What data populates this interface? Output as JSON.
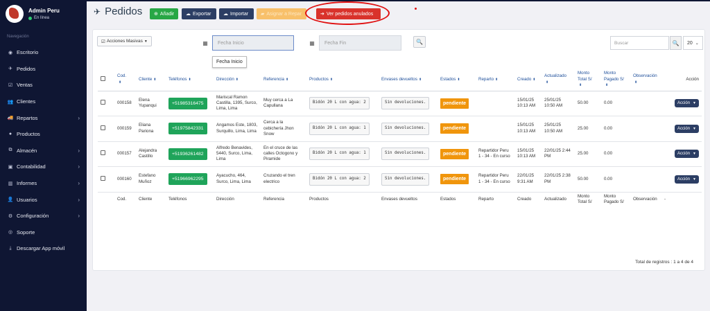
{
  "sidebar": {
    "user": {
      "name": "Admin Peru",
      "status": "En línea"
    },
    "section_label": "Navegación",
    "items": [
      {
        "label": "Escritorio",
        "icon": "dashboard-icon",
        "glyph": "◉",
        "submenu": false
      },
      {
        "label": "Pedidos",
        "icon": "rocket-icon",
        "glyph": "✈",
        "submenu": false
      },
      {
        "label": "Ventas",
        "icon": "check-square-icon",
        "glyph": "☑",
        "submenu": false
      },
      {
        "label": "Clientes",
        "icon": "users-icon",
        "glyph": "👥",
        "submenu": false
      },
      {
        "label": "Repartos",
        "icon": "truck-icon",
        "glyph": "🚚",
        "submenu": true
      },
      {
        "label": "Productos",
        "icon": "product-icon",
        "glyph": "●",
        "submenu": false
      },
      {
        "label": "Almacén",
        "icon": "cubes-icon",
        "glyph": "⧉",
        "submenu": true
      },
      {
        "label": "Contabilidad",
        "icon": "money-icon",
        "glyph": "▣",
        "submenu": true
      },
      {
        "label": "Informes",
        "icon": "bar-chart-icon",
        "glyph": "▥",
        "submenu": true
      },
      {
        "label": "Usuarios",
        "icon": "user-icon",
        "glyph": "👤",
        "submenu": true
      },
      {
        "label": "Configuración",
        "icon": "cogs-icon",
        "glyph": "⚙",
        "submenu": true
      },
      {
        "label": "Soporte",
        "icon": "support-icon",
        "glyph": "◎",
        "submenu": false
      },
      {
        "label": "Descargar App móvil",
        "icon": "download-icon",
        "glyph": "⤓",
        "submenu": false
      }
    ]
  },
  "header": {
    "title": "Pedidos",
    "buttons": {
      "add": "Añadir",
      "export": "Exportar",
      "import": "Importar",
      "assign": "Asignar a Repar",
      "voided": "Ver pedidos anulados"
    }
  },
  "toolbar": {
    "mass_actions": "Acciones Masivas",
    "date_start_placeholder": "Fecha Inicio",
    "date_end_placeholder": "Fecha Fin",
    "tooltip": "Fecha Inicio",
    "search_placeholder": "Buscar",
    "per_page": "20"
  },
  "table": {
    "headers": {
      "cod": "Cod.",
      "cliente": "Cliente",
      "telefonos": "Teléfonos",
      "direccion": "Dirección",
      "referencia": "Referencia",
      "productos": "Productos",
      "envases": "Envases devueltos",
      "estados": "Estados",
      "reparto": "Reparto",
      "creado": "Creado",
      "actualizado": "Actualizado",
      "monto_total": "Monto Total S/",
      "monto_pagado": "Monto Pagado S/",
      "observacion": "Observación",
      "accion": "Acción"
    },
    "footer": {
      "cod": "Cod.",
      "cliente": "Cliente",
      "telefonos": "Teléfonos",
      "direccion": "Dirección",
      "referencia": "Referencia",
      "productos": "Productos",
      "envases": "Envases devueltos",
      "estados": "Estados",
      "reparto": "Reparto",
      "creado": "Creado",
      "actualizado": "Actualizado",
      "monto_total": "Monto Total S/",
      "monto_pagado": "Monto Pagado S/",
      "observacion": "Observación",
      "accion": "-"
    },
    "rows": [
      {
        "cod": "000158",
        "cliente": "Elena Yupanqui",
        "telefono": "+51985316475",
        "direccion": "Mariscal Ramon Castilla, 1395, Surco, Lima, Lima",
        "referencia": "Muy cerca a La Capullana",
        "producto": "Bidón 20 L con agua: 2",
        "envases": "Sin devoluciones.",
        "estado": "pendiente",
        "reparto": "",
        "creado": "15/01/25 10:13 AM",
        "actualizado": "25/01/25 10:50 AM",
        "monto_total": "50.00",
        "monto_pagado": "0.00",
        "observacion": "",
        "accion": "Acción"
      },
      {
        "cod": "000159",
        "cliente": "Eliana Pariona",
        "telefono": "+51975842331",
        "direccion": "Angamos Este, 1803, Surquillo, Lima, Lima",
        "referencia": "Cerca a la cebichería Jhon Snow",
        "producto": "Bidón 20 L con agua: 1",
        "envases": "Sin devoluciones.",
        "estado": "pendiente",
        "reparto": "",
        "creado": "15/01/25 10:13 AM",
        "actualizado": "25/01/25 10:50 AM",
        "monto_total": "25.00",
        "monto_pagado": "0.00",
        "observacion": "",
        "accion": "Acción"
      },
      {
        "cod": "000157",
        "cliente": "Alejandra Castillo",
        "telefono": "+51936261482",
        "direccion": "Alfredo Benavides, 5440, Surco, Lima, Lima",
        "referencia": "En el cruce de las calles Octogono y Piramide",
        "producto": "Bidón 20 L con agua: 1",
        "envases": "Sin devoluciones.",
        "estado": "pendiente",
        "reparto": "Repartidor Peru 1 - 34 - En curso",
        "creado": "15/01/25 10:13 AM",
        "actualizado": "22/01/25 2:44 PM",
        "monto_total": "25.00",
        "monto_pagado": "0.00",
        "observacion": "",
        "accion": "Acción"
      },
      {
        "cod": "000160",
        "cliente": "Estefano Muñoz",
        "telefono": "+51966962295",
        "direccion": "Ayacucho, 464, Surco, Lima, Lima",
        "referencia": "Cruzando el tren electrico",
        "producto": "Bidón 20 L con agua: 2",
        "envases": "Sin devoluciones.",
        "estado": "pendiente",
        "reparto": "Repartidor Peru 1 - 34 - En curso",
        "creado": "22/01/25 9:31 AM",
        "actualizado": "22/01/25 2:38 PM",
        "monto_total": "50.00",
        "monto_pagado": "0.00",
        "observacion": "",
        "accion": "Acción"
      }
    ],
    "total_records": "Total de registros : 1 a 4 de 4"
  },
  "colors": {
    "sidebar_bg": "#0f1633",
    "primary_dark": "#2c3e64",
    "success": "#28a745",
    "danger": "#d9322b",
    "warning": "#f0950c",
    "annotation": "#e01010"
  }
}
